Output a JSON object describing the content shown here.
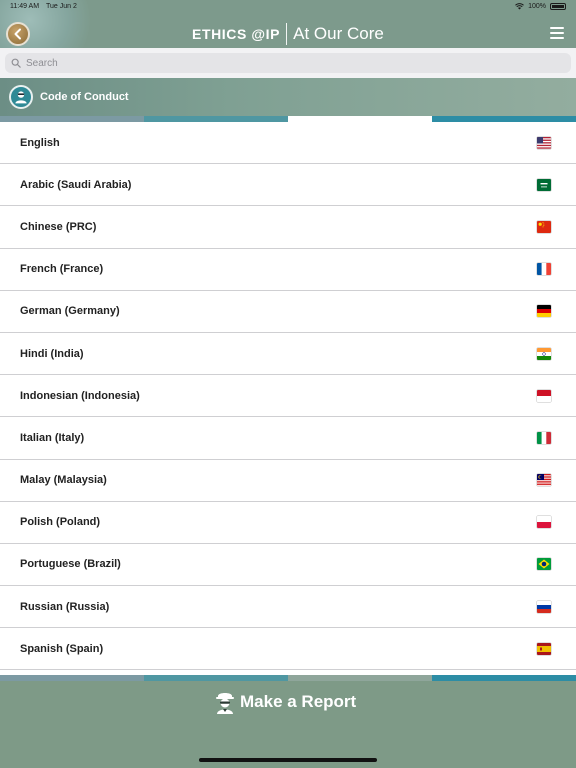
{
  "status": {
    "time": "11:49 AM",
    "date": "Tue Jun 2",
    "battery": "100%"
  },
  "header": {
    "brand_left": "ETHICS @IP",
    "brand_right": "At Our Core"
  },
  "search": {
    "placeholder": "Search"
  },
  "section": {
    "title": "Code of Conduct"
  },
  "languages": [
    {
      "label": "English",
      "flag": "us-flag-icon"
    },
    {
      "label": "Arabic (Saudi Arabia)",
      "flag": "sa-flag-icon"
    },
    {
      "label": "Chinese (PRC)",
      "flag": "cn-flag-icon"
    },
    {
      "label": "French (France)",
      "flag": "fr-flag-icon"
    },
    {
      "label": "German (Germany)",
      "flag": "de-flag-icon"
    },
    {
      "label": "Hindi (India)",
      "flag": "in-flag-icon"
    },
    {
      "label": "Indonesian (Indonesia)",
      "flag": "id-flag-icon"
    },
    {
      "label": "Italian (Italy)",
      "flag": "it-flag-icon"
    },
    {
      "label": "Malay (Malaysia)",
      "flag": "my-flag-icon"
    },
    {
      "label": "Polish (Poland)",
      "flag": "pl-flag-icon"
    },
    {
      "label": "Portuguese (Brazil)",
      "flag": "br-flag-icon"
    },
    {
      "label": "Russian (Russia)",
      "flag": "ru-flag-icon"
    },
    {
      "label": "Spanish (Spain)",
      "flag": "es-flag-icon"
    }
  ],
  "footer": {
    "report_label": "Make a Report"
  },
  "colors": {
    "header_bg": "#7d9a8c",
    "footer_bg": "#7e9a87",
    "accent_teal": "#2d8da5"
  }
}
